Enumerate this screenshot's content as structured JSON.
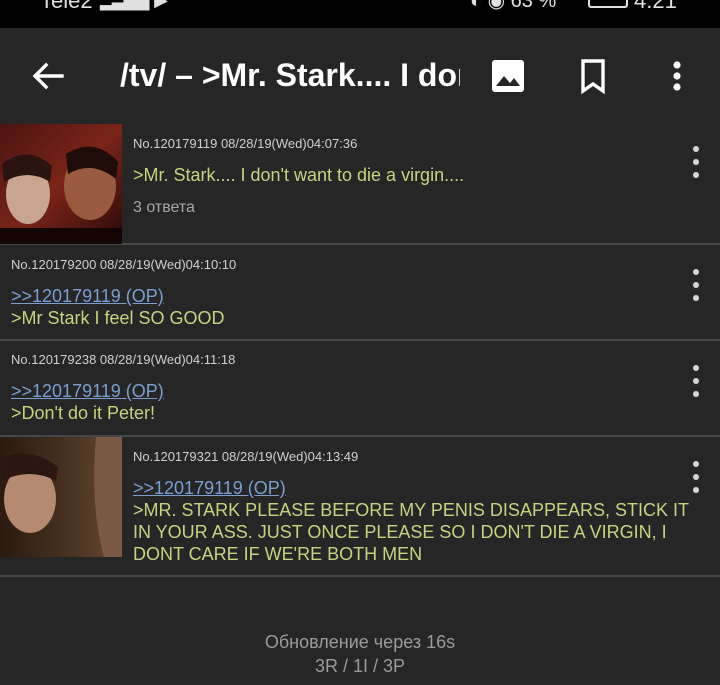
{
  "status_bar": {
    "carrier": "Tele2",
    "battery": "63 %",
    "time": "4:21"
  },
  "toolbar": {
    "title": "/tv/ – >Mr. Stark.... I don't want to die a virgin...."
  },
  "posts": [
    {
      "meta": "No.120179119 08/28/19(Wed)04:07:36",
      "quote": "",
      "text": ">Mr. Stark.... I don't want to die a virgin....",
      "replies": "3 ответа"
    },
    {
      "meta": "No.120179200 08/28/19(Wed)04:10:10",
      "quote": ">>120179119 (OP)",
      "text": ">Mr Stark I feel SO GOOD"
    },
    {
      "meta": "No.120179238 08/28/19(Wed)04:11:18",
      "quote": ">>120179119 (OP)",
      "text": ">Don't do it Peter!"
    },
    {
      "meta": "No.120179321 08/28/19(Wed)04:13:49",
      "quote": ">>120179119 (OP)",
      "text": ">MR. STARK PLEASE BEFORE MY PENIS DISAPPEARS, STICK IT IN YOUR ASS. JUST ONCE PLEASE SO I DON'T DIE A VIRGIN, I DONT CARE IF WE'RE BOTH MEN"
    }
  ],
  "footer": {
    "update": "Обновление через 16s",
    "stats": "3R / 1I / 3P"
  },
  "icons": {
    "back": "arrow-left-icon",
    "gallery": "image-icon",
    "bookmark": "bookmark-icon",
    "overflow": "more-vert-icon"
  }
}
